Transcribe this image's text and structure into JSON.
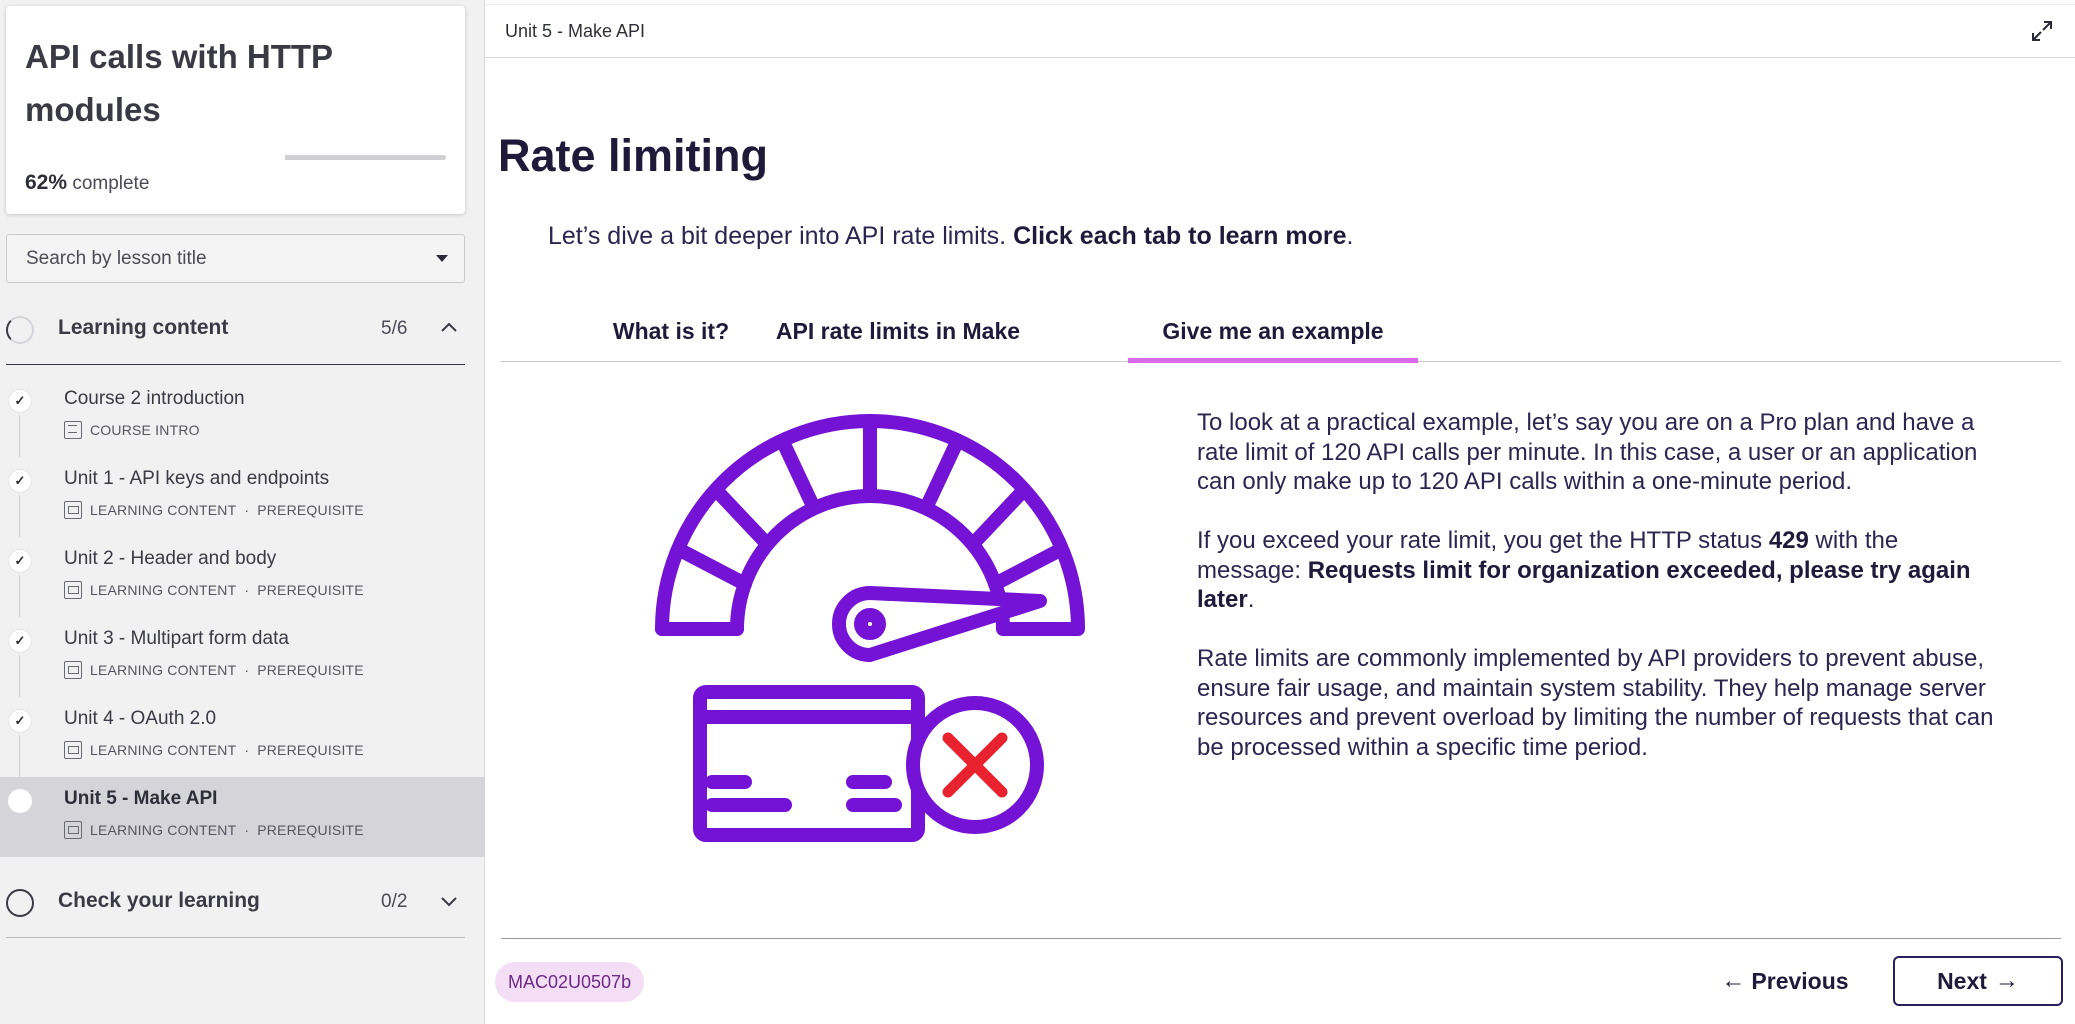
{
  "sidebar": {
    "course_title": "API calls with HTTP modules",
    "progress_percent": "62%",
    "progress_label": "complete",
    "progress_value": 0.62,
    "search_placeholder": "Search by lesson title",
    "sections": [
      {
        "title": "Learning content",
        "count": "5/6",
        "expanded": true,
        "lessons": [
          {
            "title": "Course 2 introduction",
            "type": "COURSE INTRO",
            "tag": "",
            "completed": true
          },
          {
            "title": "Unit 1 - API keys and endpoints",
            "type": "LEARNING CONTENT",
            "tag": "PREREQUISITE",
            "completed": true
          },
          {
            "title": "Unit 2 - Header and body",
            "type": "LEARNING CONTENT",
            "tag": "PREREQUISITE",
            "completed": true
          },
          {
            "title": "Unit 3 - Multipart form data",
            "type": "LEARNING CONTENT",
            "tag": "PREREQUISITE",
            "completed": true
          },
          {
            "title": "Unit 4 - OAuth 2.0",
            "type": "LEARNING CONTENT",
            "tag": "PREREQUISITE",
            "completed": true
          },
          {
            "title": "Unit 5 - Make API",
            "type": "LEARNING CONTENT",
            "tag": "PREREQUISITE",
            "completed": false,
            "active": true
          }
        ]
      },
      {
        "title": "Check your learning",
        "count": "0/2",
        "expanded": false
      }
    ],
    "separator": "·"
  },
  "main": {
    "unit_title": "Unit 5 - Make API",
    "heading": "Rate limiting",
    "intro_plain": "Let’s dive a bit deeper into API rate limits. ",
    "intro_bold": "Click each tab to learn more",
    "intro_end": ".",
    "tabs": [
      {
        "label": "What is it?",
        "active": false
      },
      {
        "label": "API rate limits in Make",
        "active": false
      },
      {
        "label": "Give me an example",
        "active": true
      }
    ],
    "paragraph1": "To look at a practical example, let’s say you are on a Pro plan and have a rate limit of 120 API calls per minute. In this case, a user or an application can only make up to 120 API calls within a one-minute period.",
    "paragraph2_a": "If you exceed your rate limit, you get the HTTP status ",
    "paragraph2_code": "429",
    "paragraph2_b": " with the message: ",
    "paragraph2_msg": "Requests limit for organization exceeded, please try again later",
    "paragraph2_end": ".",
    "paragraph3": "Rate limits are commonly implemented by API providers to prevent abuse, ensure fair usage, and maintain system stability. They help manage server resources and prevent overload by limiting the number of requests that can be processed within a specific time period.",
    "code_badge": "MAC02U0507b",
    "previous_label": "Previous",
    "next_label": "Next",
    "illustration": "speedometer-card-error-icon"
  },
  "colors": {
    "illustration": "#7412d6",
    "error": "#e8232f",
    "tab_underline": "#d86aee",
    "heading": "#1f1a3a",
    "badge_bg": "#f3def5",
    "badge_text": "#6b2a88"
  }
}
